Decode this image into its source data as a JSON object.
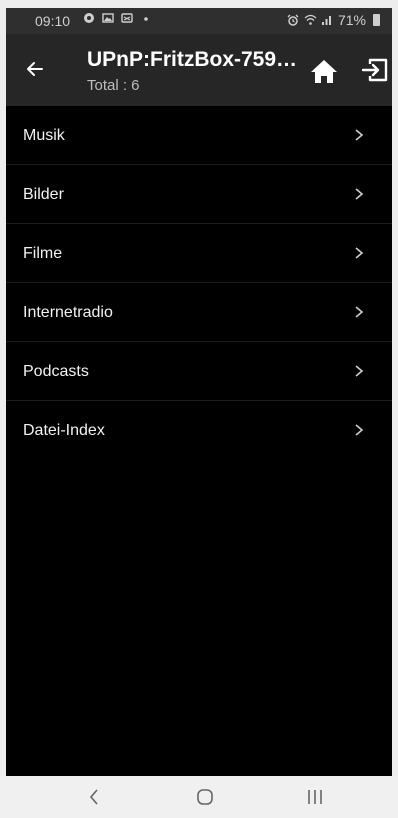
{
  "status_bar": {
    "time": "09:10",
    "battery": "71%",
    "left_icons": [
      "app-notification-icon",
      "image-icon",
      "cast-icon",
      "dot-icon"
    ],
    "right_icons": [
      "alarm-icon",
      "wifi-icon",
      "signal-icon",
      "battery-icon"
    ]
  },
  "header": {
    "title": "UPnP:FritzBox-759…",
    "subtitle": "Total : 6",
    "background": "#262626"
  },
  "list": {
    "items": [
      {
        "label": "Musik"
      },
      {
        "label": "Bilder"
      },
      {
        "label": "Filme"
      },
      {
        "label": "Internetradio"
      },
      {
        "label": "Podcasts"
      },
      {
        "label": "Datei-Index"
      }
    ]
  },
  "nav_bar": {
    "icons": [
      "back-nav-icon",
      "home-nav-icon",
      "recents-nav-icon"
    ]
  }
}
